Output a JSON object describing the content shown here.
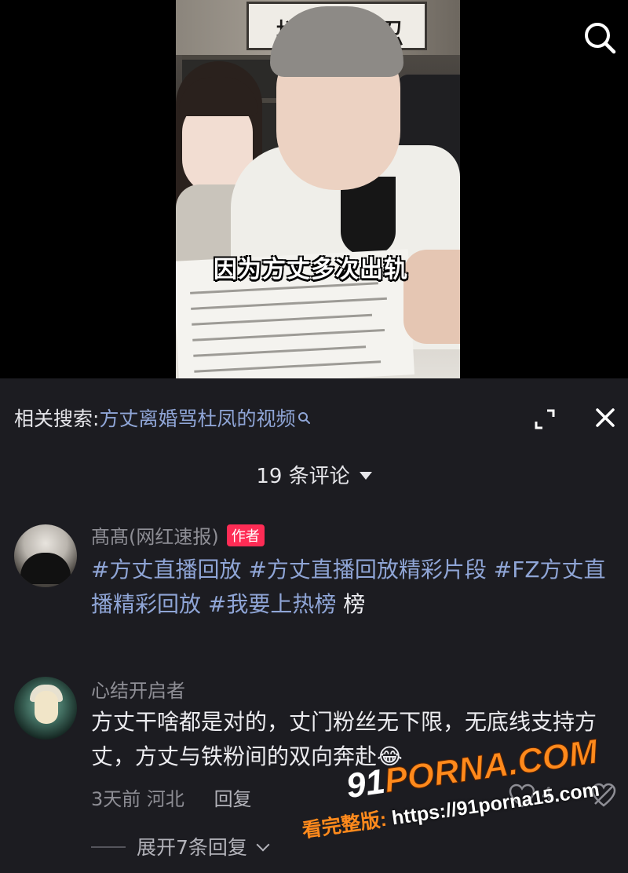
{
  "video": {
    "caption": "因为方丈多次出轨",
    "calligraphy_left": "挝",
    "calligraphy_right": "忍"
  },
  "header": {
    "search_icon": "search-icon"
  },
  "sheet": {
    "related_label": "相关搜索:",
    "related_query": "方丈离婚骂杜凤的视频",
    "comment_count_label": "19 条评论",
    "expand_icon": "expand-icon",
    "close_icon": "close-icon"
  },
  "comments": [
    {
      "username": "髙髙(网红速报)",
      "badge": "作者",
      "hashtags": [
        "#方丈直播回放",
        "#方丈直播回放精彩片段",
        "#FZ方丈直播精彩回放",
        "#我要上热榜"
      ],
      "trailing_text": "榜"
    },
    {
      "username": "心结开启者",
      "text": "方丈干啥都是对的，丈门粉丝无下限，无底线支持方丈，方丈与铁粉间的双向奔赴😂",
      "time": "3天前",
      "location": "河北",
      "reply_label": "回复",
      "like_count": "4",
      "expand_replies_label": "展开7条回复"
    }
  ],
  "watermark": {
    "logo_number": "91",
    "logo_brand": "PORNA.COM",
    "label": "看完整版:",
    "url": "https://91porna15.com"
  },
  "colors": {
    "sheet_bg": "#1c1c21",
    "link": "#8fa5d6",
    "author_badge": "#fe2c55",
    "watermark_orange": "#ff8a1c"
  }
}
